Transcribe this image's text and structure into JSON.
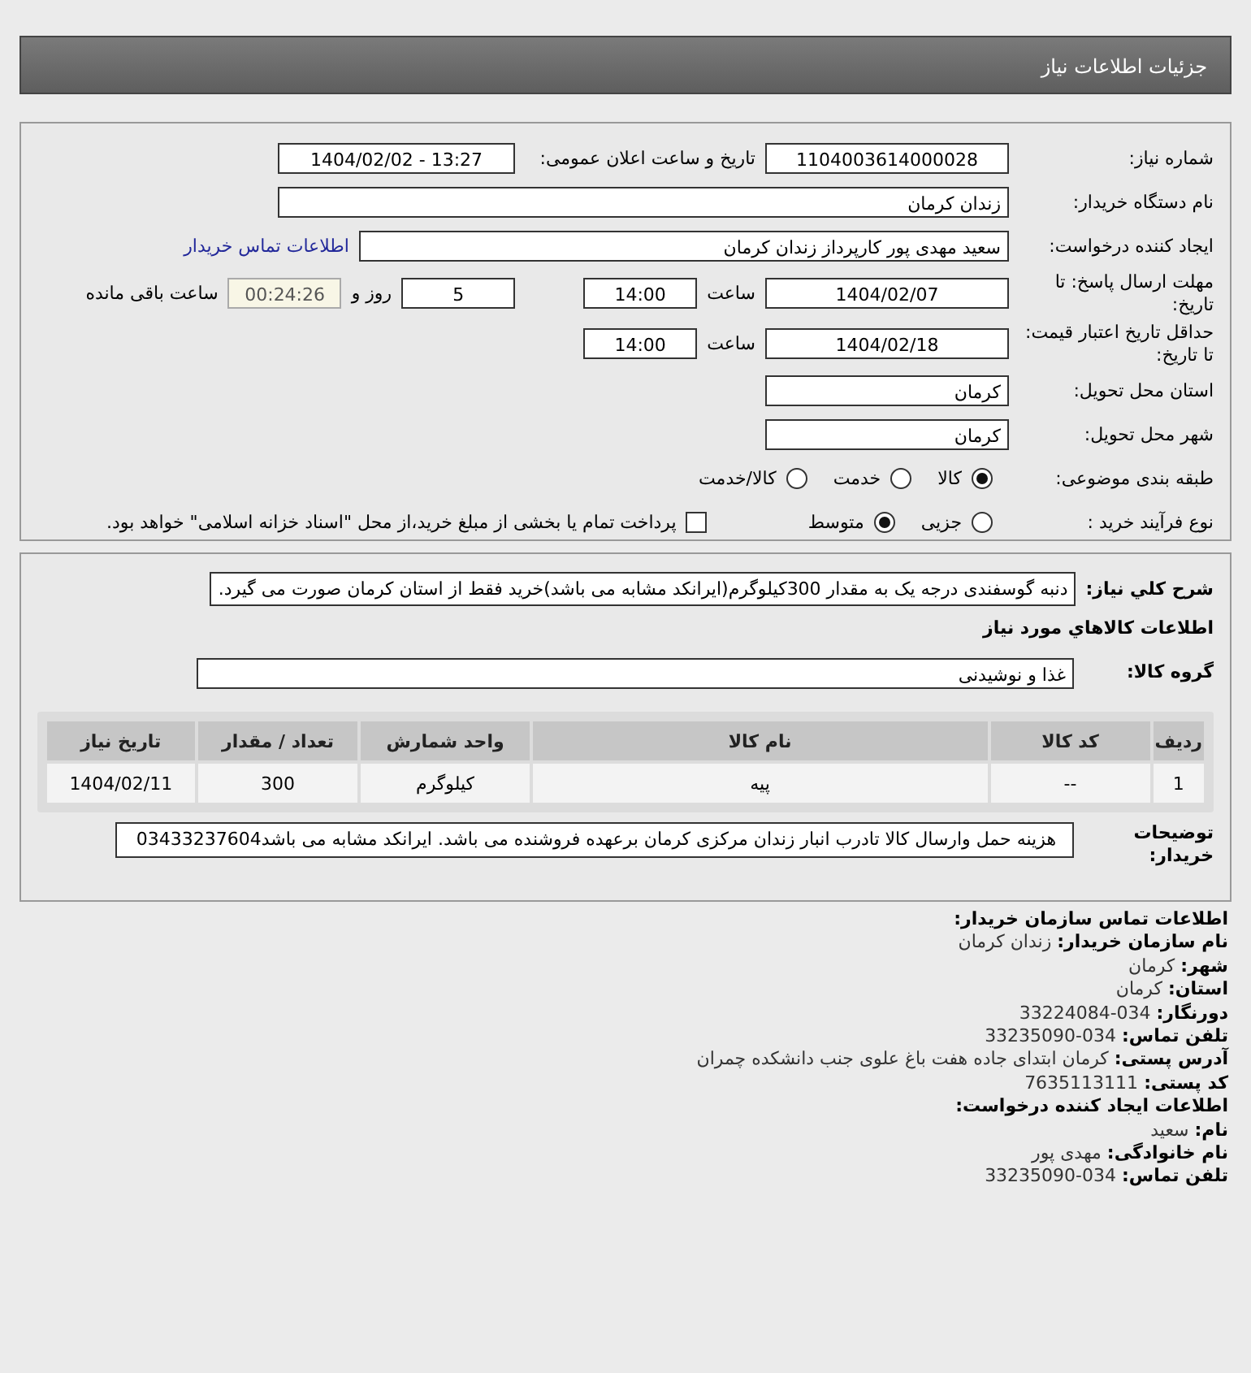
{
  "header": {
    "title": "جزئیات اطلاعات نیاز"
  },
  "need_number": {
    "label": "شماره نیاز:",
    "value": "1104003614000028"
  },
  "announce": {
    "label": "تاریخ و ساعت اعلان عمومی:",
    "value": "1404/02/02 - 13:27"
  },
  "buyer": {
    "label": "نام دستگاه خریدار:",
    "value": "زندان کرمان"
  },
  "creator": {
    "label": "ایجاد کننده درخواست:",
    "value": "سعید مهدی پور کارپرداز زندان کرمان",
    "link": "اطلاعات تماس خریدار"
  },
  "deadline": {
    "label": "مهلت ارسال پاسخ: تا تاریخ:",
    "date": "1404/02/07",
    "time_label": "ساعت",
    "time": "14:00",
    "days": "5",
    "days_label": "روز و",
    "remaining": "00:24:26",
    "remaining_label": "ساعت باقی مانده"
  },
  "validity": {
    "label": "حداقل تاریخ اعتبار قیمت: تا تاریخ:",
    "date": "1404/02/18",
    "time_label": "ساعت",
    "time": "14:00"
  },
  "province": {
    "label": "استان محل تحویل:",
    "value": "کرمان"
  },
  "city": {
    "label": "شهر محل تحویل:",
    "value": "کرمان"
  },
  "category": {
    "label": "طبقه بندی موضوعی:",
    "options": [
      {
        "label": "کالا",
        "selected": true
      },
      {
        "label": "خدمت",
        "selected": false
      },
      {
        "label": "کالا/خدمت",
        "selected": false
      }
    ]
  },
  "process": {
    "label": "نوع فرآیند خرید :",
    "options": [
      {
        "label": "جزیی",
        "selected": false
      },
      {
        "label": "متوسط",
        "selected": true
      }
    ],
    "payment": {
      "label": "پرداخت تمام یا بخشی از مبلغ خرید،از محل \"اسناد خزانه اسلامی\" خواهد بود.",
      "checked": false
    }
  },
  "summary": {
    "label": "شرح کلي نياز:",
    "value": "دنبه گوسفندی درجه یک به مقدار 300کیلوگرم(ایرانکد مشابه می باشد)خرید فقط از استان کرمان صورت می گیرد."
  },
  "goods_heading": "اطلاعات کالاهاي مورد نياز",
  "group": {
    "label": "گروه کالا:",
    "value": "غذا و نوشیدنی"
  },
  "table": {
    "columns": [
      "ردیف",
      "کد کالا",
      "نام کالا",
      "واحد شمارش",
      "تعداد / مقدار",
      "تاریخ نیاز"
    ],
    "rows": [
      [
        "1",
        "--",
        "پیه",
        "کیلوگرم",
        "300",
        "1404/02/11"
      ]
    ]
  },
  "buyer_notes": {
    "label": "توضیحات خریدار:",
    "value": "هزینه حمل وارسال کالا تادرب انبار زندان مرکزی کرمان برعهده فروشنده می باشد. ایرانکد مشابه می باشد03433237604"
  },
  "contact": [
    {
      "kind": "heading",
      "label": "اطلاعات تماس سازمان خریدار:"
    },
    {
      "kind": "field",
      "label": "نام سازمان خریدار:",
      "value": "زندان کرمان"
    },
    {
      "kind": "field",
      "label": "شهر:",
      "value": "کرمان"
    },
    {
      "kind": "field",
      "label": "استان:",
      "value": "کرمان"
    },
    {
      "kind": "number",
      "label": "دورنگار:",
      "value": "33224084-034"
    },
    {
      "kind": "number",
      "label": "تلفن تماس:",
      "value": "33235090-034"
    },
    {
      "kind": "field",
      "label": "آدرس پستی:",
      "value": "کرمان ابتدای جاده هفت باغ علوی جنب دانشکده چمران"
    },
    {
      "kind": "number",
      "label": "کد پستی:",
      "value": "7635113111"
    },
    {
      "kind": "heading",
      "label": "اطلاعات ایجاد کننده درخواست:"
    },
    {
      "kind": "field",
      "label": "نام:",
      "value": "سعید"
    },
    {
      "kind": "field",
      "label": "نام خانوادگی:",
      "value": "مهدی پور"
    },
    {
      "kind": "number",
      "label": "تلفن تماس:",
      "value": "33235090-034"
    }
  ]
}
